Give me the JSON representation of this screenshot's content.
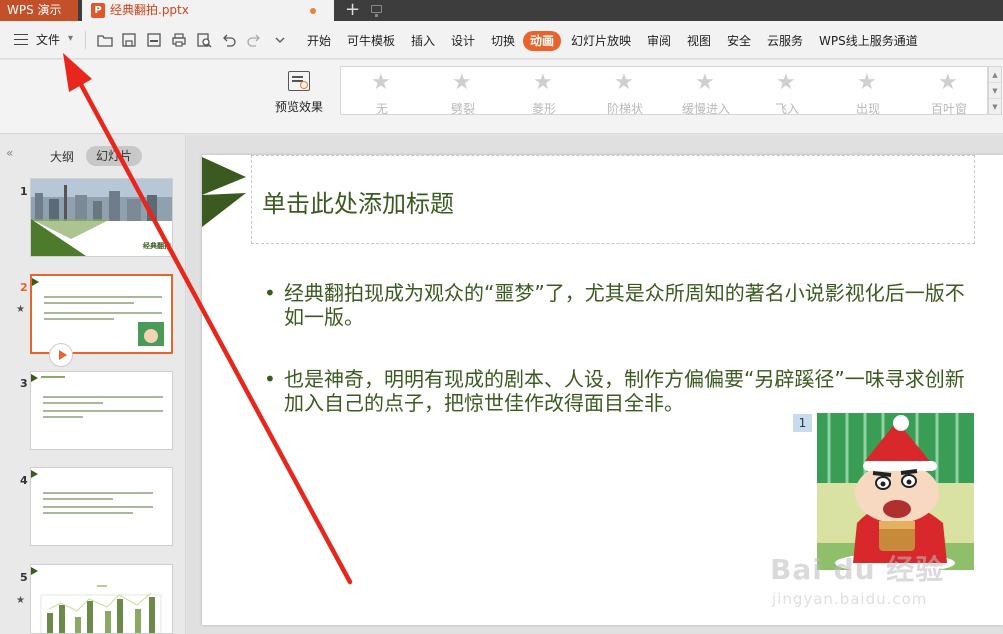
{
  "titlebar": {
    "app_tab": "WPS 演示",
    "doc_tab": "经典翻拍.pptx",
    "doc_icon_letter": "P",
    "new_tab": "+"
  },
  "menubar": {
    "file_label": "文件",
    "tabs": [
      "开始",
      "可牛模板",
      "插入",
      "设计",
      "切换",
      "动画",
      "幻灯片放映",
      "审阅",
      "视图",
      "安全",
      "云服务",
      "WPS线上服务通道"
    ],
    "active_tab": "动画"
  },
  "ribbon": {
    "preview_label": "预览效果",
    "effects": [
      "无",
      "劈裂",
      "菱形",
      "阶梯状",
      "缓慢进入",
      "飞入",
      "出现",
      "百叶窗"
    ]
  },
  "left_panel": {
    "outline_tab": "大纲",
    "slides_tab": "幻灯片",
    "slide_numbers": [
      "1",
      "2",
      "3",
      "4",
      "5"
    ],
    "slide1_caption": "经典翻拍"
  },
  "slide": {
    "title": "单击此处添加标题",
    "bullets": [
      "经典翻拍现成为观众的“噩梦”了，尤其是众所周知的著名小说影视化后一版不如一版。",
      "也是神奇，明明有现成的剧本、人设，制作方偏偏要“另辟蹊径”一味寻求创新加入自己的点子，把惊世佳作改得面目全非。"
    ],
    "animation_badge": "1"
  },
  "watermark": {
    "main": "Bai du 经验",
    "sub": "jingyan.baidu.com"
  },
  "colors": {
    "accent": "#e8642c",
    "title_green": "#3b5a1f",
    "app_tab": "#c4502a",
    "annotation_arrow": "#e8261c"
  }
}
